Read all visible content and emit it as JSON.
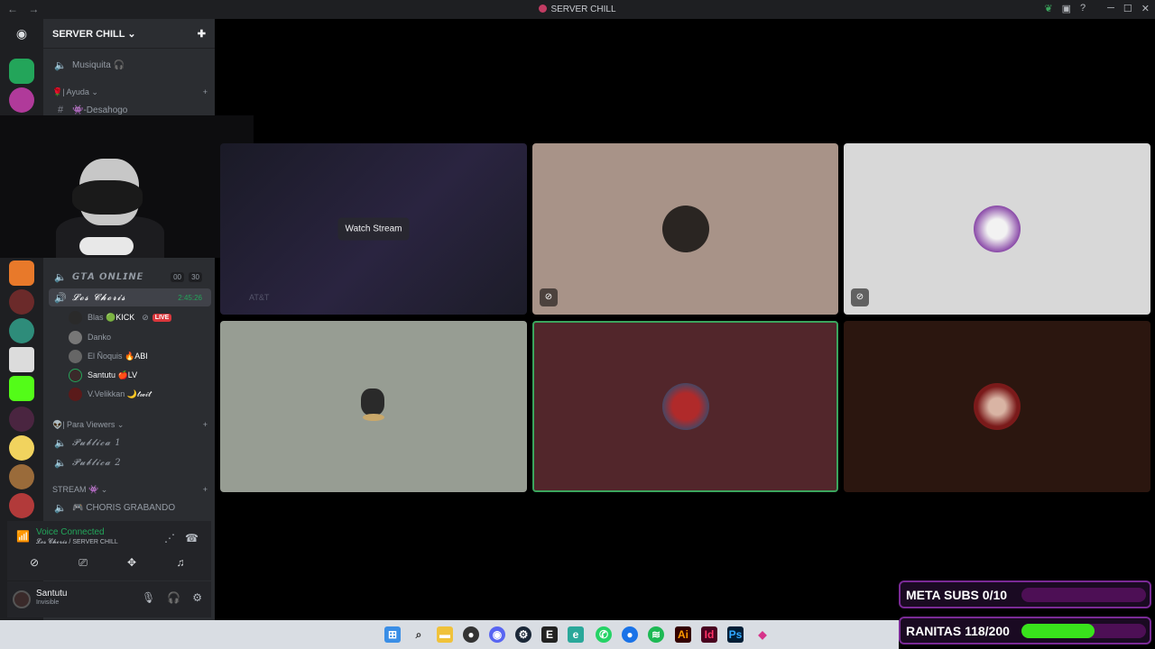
{
  "window": {
    "title": "SERVER CHILL",
    "nav_back": "←",
    "nav_fwd": "→"
  },
  "guild": {
    "name": "SERVER CHILL",
    "chevron": "⌄"
  },
  "channels": {
    "musiquita": "Musiquita 🎧",
    "cat_ayuda": "🌹| Ayuda ⌄",
    "desahogo": "👾-Desahogo",
    "gta": "𝙂𝙏𝘼 𝙊𝙉𝙇𝙄𝙉𝙀",
    "gta_count_a": "00",
    "gta_count_b": "30",
    "los_choris": "𝓛𝓸𝓼 𝓒𝓱𝓸𝓻𝓲𝓼",
    "los_choris_timer": "2:45:26",
    "cat_para_viewers": "👽| Para Viewers ⌄",
    "publica1": "𝓟𝓾𝓫𝓵𝓲𝓬𝓪 1",
    "publica2": "𝓟𝓾𝓫𝓵𝓲𝓬𝓪 2",
    "cat_stream": "STREAM 👾 ⌄",
    "choris_grabando": "🎮 CHORIS GRABANDO"
  },
  "voice_members": [
    {
      "name": "Blas",
      "tag": "🟢KICK",
      "live": "LIVE"
    },
    {
      "name": "Danko",
      "tag": ""
    },
    {
      "name": "El Ñoquis",
      "tag": "🔥ABI"
    },
    {
      "name": "Santutu",
      "tag": "🍎LV"
    },
    {
      "name": "V.Velikkan",
      "tag": "🌙𝓉𝓌𝒾𝓉"
    }
  ],
  "voice_panel": {
    "status": "Voice Connected",
    "location": "𝓛𝓸𝓼 𝓒𝓱𝓸𝓻𝓲𝓼 / SERVER CHILL"
  },
  "user_panel": {
    "name": "Santutu",
    "status": "Invisible"
  },
  "stream_tile": {
    "watch_label": "Watch Stream",
    "overlay_text": "AT&T"
  },
  "goals": {
    "meta_subs": {
      "label": "META SUBS 0/10",
      "current": 0,
      "target": 10
    },
    "ranitas": {
      "label": "RANITAS 118/200",
      "current": 118,
      "target": 200
    }
  },
  "colors": {
    "accent_green": "#23a55a",
    "live_red": "#da373c",
    "goal_fill": "#39e31c",
    "goal_border": "#7a2a96"
  }
}
